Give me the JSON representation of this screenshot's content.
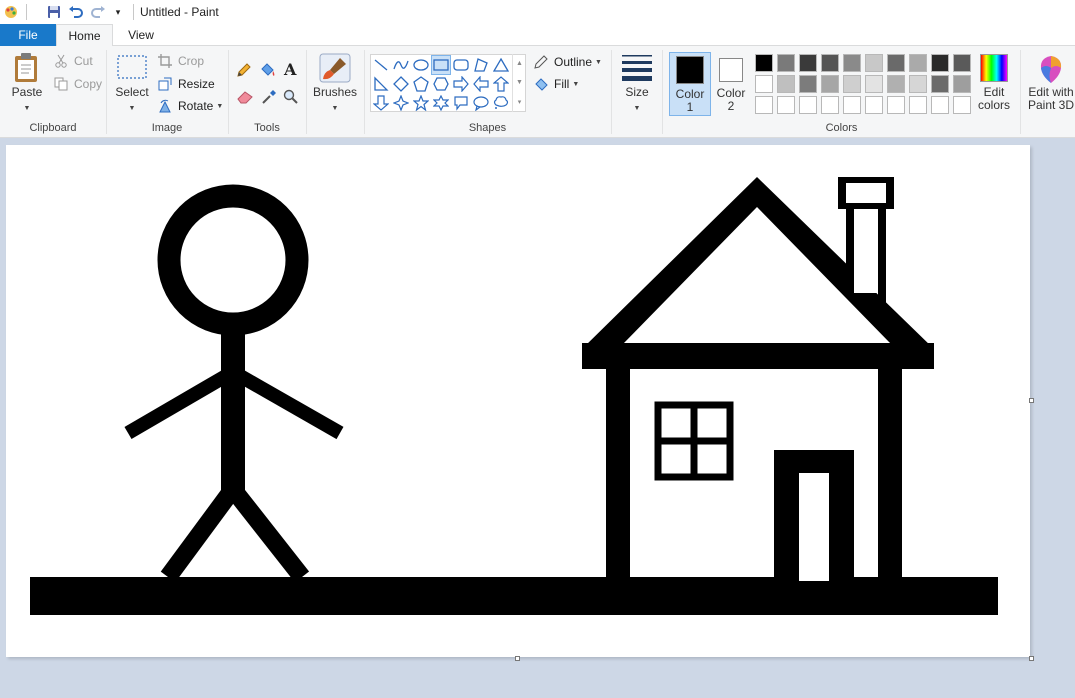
{
  "window": {
    "title": "Untitled - Paint"
  },
  "quick_access": {
    "icons": [
      "paint-app-icon",
      "save-icon",
      "undo-icon",
      "redo-icon",
      "customize-dropdown-icon"
    ]
  },
  "tabs": {
    "file": "File",
    "home": "Home",
    "view": "View"
  },
  "clipboard": {
    "paste": "Paste",
    "cut": "Cut",
    "copy": "Copy",
    "group": "Clipboard"
  },
  "image": {
    "select": "Select",
    "crop": "Crop",
    "resize": "Resize",
    "rotate": "Rotate",
    "group": "Image"
  },
  "tools": {
    "group": "Tools",
    "items": [
      "pencil-icon",
      "fill-bucket-icon",
      "text-icon",
      "eraser-icon",
      "color-picker-icon",
      "magnifier-icon"
    ]
  },
  "brushes": {
    "label": "Brushes"
  },
  "shapes": {
    "group": "Shapes",
    "outline": "Outline",
    "fill": "Fill",
    "selected": "rectangle",
    "items": [
      "line",
      "curve",
      "oval",
      "rectangle",
      "rounded-rectangle",
      "polygon",
      "triangle",
      "right-triangle",
      "diamond",
      "pentagon",
      "hexagon",
      "right-arrow",
      "left-arrow",
      "up-arrow",
      "down-arrow",
      "four-point-star",
      "five-point-star",
      "six-point-star",
      "rounded-callout",
      "oval-callout",
      "cloud-callout"
    ]
  },
  "size": {
    "label": "Size"
  },
  "colors": {
    "group": "Colors",
    "color1": {
      "label": "Color",
      "num": "1",
      "value": "#000000"
    },
    "color2": {
      "label": "Color",
      "num": "2",
      "value": "#ffffff"
    },
    "edit": {
      "line1": "Edit",
      "line2": "colors"
    },
    "palette_row1": [
      "#000000",
      "#7a7a7a",
      "#3a3a3a",
      "#555555",
      "#8a8a8a",
      "#c8c8c8",
      "#6a6a6a",
      "#aaaaaa",
      "#2a2a2a",
      "#5a5a5a"
    ],
    "palette_row2": [
      "#ffffff",
      "#bfbfbf",
      "#7c7c7c",
      "#a6a6a6",
      "#cfcfcf",
      "#e3e3e3",
      "#b0b0b0",
      "#d6d6d6",
      "#6b6b6b",
      "#9e9e9e"
    ]
  },
  "paint3d": {
    "line1": "Edit with",
    "line2": "Paint 3D"
  }
}
